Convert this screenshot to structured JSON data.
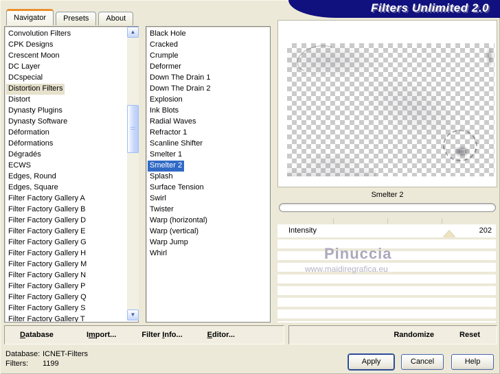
{
  "window": {
    "title": "Filters Unlimited 2.0"
  },
  "tabs": [
    {
      "label": "Navigator",
      "active": true
    },
    {
      "label": "Presets",
      "active": false
    },
    {
      "label": "About",
      "active": false
    }
  ],
  "category_list": {
    "selected_index": 5,
    "items": [
      "Convolution Filters",
      "CPK Designs",
      "Crescent Moon",
      "DC Layer",
      "DCspecial",
      "Distortion Filters",
      "Distort",
      "Dynasty Plugins",
      "Dynasty Software",
      "Déformation",
      "Déformations",
      "Dégradés",
      "ECWS",
      "Edges, Round",
      "Edges, Square",
      "Filter Factory Gallery A",
      "Filter Factory Gallery B",
      "Filter Factory Gallery D",
      "Filter Factory Gallery E",
      "Filter Factory Gallery G",
      "Filter Factory Gallery H",
      "Filter Factory Gallery M",
      "Filter Factory Gallery N",
      "Filter Factory Gallery P",
      "Filter Factory Gallery Q",
      "Filter Factory Gallery S",
      "Filter Factory Gallery T"
    ]
  },
  "filter_list": {
    "selected_index": 12,
    "items": [
      "Black Hole",
      "Cracked",
      "Crumple",
      "Deformer",
      "Down The Drain 1",
      "Down The Drain 2",
      "Explosion",
      "Ink Blots",
      "Radial Waves",
      "Refractor 1",
      "Scanline Shifter",
      "Smelter 1",
      "Smelter 2",
      "Splash",
      "Surface Tension",
      "Swirl",
      "Twister",
      "Warp (horizontal)",
      "Warp (vertical)",
      "Warp Jump",
      "Whirl"
    ]
  },
  "preview": {
    "filter_caption": "Smelter 2",
    "progress_percent": 0
  },
  "parameters": {
    "rows": [
      {
        "label": "Intensity",
        "value": "202"
      }
    ]
  },
  "watermark": {
    "line1": "Pinuccia",
    "line2": "www.maidiregrafica.eu"
  },
  "toolbar": {
    "left": [
      {
        "pre": "",
        "key": "D",
        "post": "atabase"
      },
      {
        "pre": "I",
        "key": "m",
        "post": "port..."
      },
      {
        "pre": "Filter ",
        "key": "I",
        "post": "nfo..."
      },
      {
        "pre": "",
        "key": "E",
        "post": "ditor..."
      }
    ],
    "randomize_label": "Randomize",
    "reset_label": "Reset"
  },
  "status": {
    "database_label": "Database:",
    "database_value": "ICNET-Filters",
    "filters_label": "Filters:",
    "filters_value": "1199"
  },
  "action_buttons": {
    "apply": "Apply",
    "cancel": "Cancel",
    "help": "Help"
  },
  "icons": {
    "scroll_up": "▲",
    "scroll_down": "▼"
  },
  "colors": {
    "dialog_bg": "#ECE9D8",
    "banner": "#10107E",
    "selection_blue": "#316AC5",
    "selection_beige": "#E5E1CB",
    "tab_accent_orange": "#E9902A"
  }
}
